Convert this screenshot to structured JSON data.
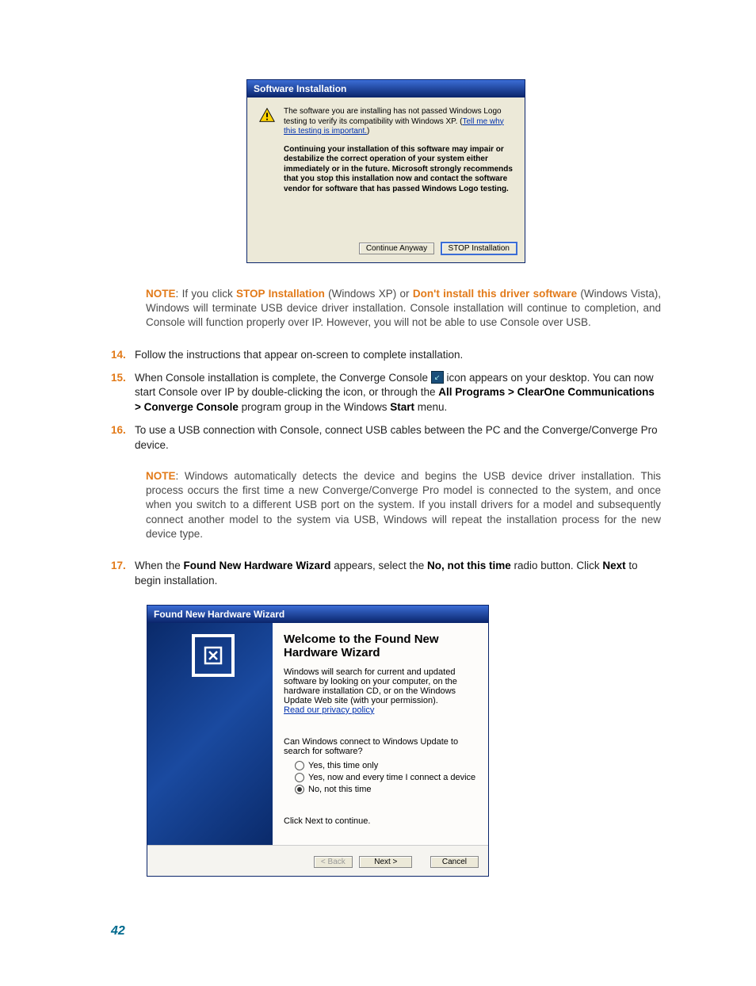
{
  "page_number": "42",
  "dialog1": {
    "title": "Software Installation",
    "msg_p1": "The software you are installing has not passed Windows Logo testing to verify its compatibility with Windows XP. (",
    "msg_link": "Tell me why this testing is important.",
    "msg_p1_close": ")",
    "msg_bold": "Continuing your installation of this software may impair or destabilize the correct operation of your system either immediately or in the future. Microsoft strongly recommends that you stop this installation now and contact the software vendor for software that has passed Windows Logo testing.",
    "btn_continue": "Continue Anyway",
    "btn_stop": "STOP Installation"
  },
  "note1": {
    "label": "NOTE",
    "pre": ": If you click ",
    "stop_bold": "STOP Installation",
    "mid1": " (Windows XP) or ",
    "dont_bold": "Don't install this driver software",
    "rest": " (Windows Vista), Windows will terminate USB device driver installation. Console installation will continue to completion, and Console will function properly over IP. However, you will not be able to use Console over USB."
  },
  "step14": {
    "num": "14.",
    "text": "Follow the instructions that appear on-screen to complete installation."
  },
  "step15": {
    "num": "15.",
    "t1": "When Console installation is complete, the Converge Console ",
    "t2": " icon appears on your desktop. You can now start Console over IP by double-clicking the icon, or through the ",
    "path": "All Programs > ClearOne Communications > Converge Console",
    "t3": " program group in the Windows ",
    "start": "Start",
    "t4": " menu."
  },
  "step16": {
    "num": "16.",
    "text": "To use a USB connection with Console, connect USB cables between the PC and the Converge/Converge Pro device."
  },
  "note2": {
    "label": "NOTE",
    "text": ": Windows automatically detects the device and begins the USB device driver installation. This process occurs the first time a new Converge/Converge Pro model is connected to the system, and once when you switch to a different USB port on the system. If you install drivers for a model and subsequently connect another model to the system via USB, Windows will repeat the installation process for the new device type."
  },
  "step17": {
    "num": "17.",
    "t1": "When the ",
    "wiz": "Found New Hardware Wizard",
    "t2": " appears, select the ",
    "no": "No, not this time",
    "t3": " radio button. Click ",
    "next": "Next",
    "t4": " to begin installation."
  },
  "dialog2": {
    "title": "Found New Hardware Wizard",
    "heading": "Welcome to the Found New Hardware Wizard",
    "intro": "Windows will search for current and updated software by looking on your computer, on the hardware installation CD, or on the Windows Update Web site (with your permission).",
    "privacy_link": "Read our privacy policy",
    "question": "Can Windows connect to Windows Update to search for software?",
    "opt1": "Yes, this time only",
    "opt2": "Yes, now and every time I connect a device",
    "opt3": "No, not this time",
    "click_next": "Click Next to continue.",
    "btn_back": "< Back",
    "btn_next": "Next >",
    "btn_cancel": "Cancel"
  }
}
